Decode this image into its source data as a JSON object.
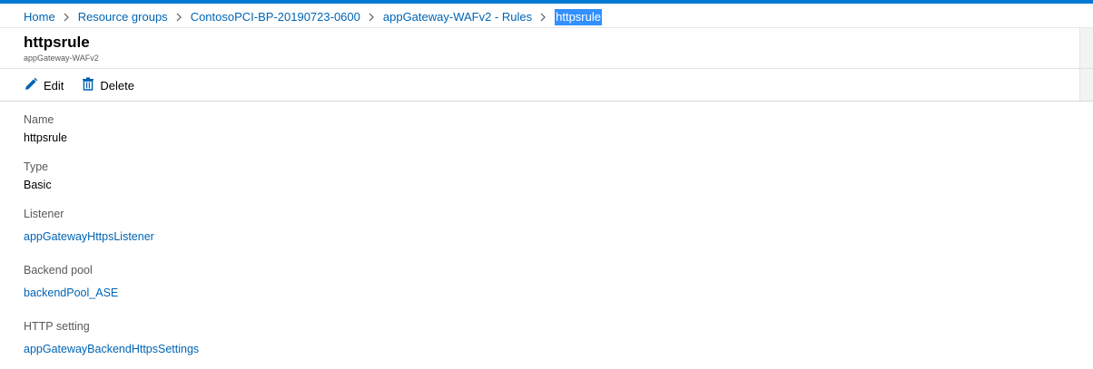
{
  "breadcrumb": {
    "items": [
      "Home",
      "Resource groups",
      "ContosoPCI-BP-20190723-0600",
      "appGateway-WAFv2 - Rules"
    ],
    "current": "httpsrule"
  },
  "header": {
    "title": "httpsrule",
    "subtitle": "appGateway-WAFv2"
  },
  "toolbar": {
    "edit_label": "Edit",
    "edit_icon": "pencil-icon",
    "delete_label": "Delete",
    "delete_icon": "trash-icon"
  },
  "fields": {
    "name": {
      "label": "Name",
      "value": "httpsrule"
    },
    "type": {
      "label": "Type",
      "value": "Basic"
    },
    "listener": {
      "label": "Listener",
      "value": "appGatewayHttpsListener"
    },
    "backend_pool": {
      "label": "Backend pool",
      "value": "backendPool_ASE"
    },
    "http_setting": {
      "label": "HTTP setting",
      "value": "appGatewayBackendHttpsSettings"
    }
  },
  "colors": {
    "accent": "#0078d4",
    "link": "#0064b4",
    "selection": "#3390ff"
  }
}
